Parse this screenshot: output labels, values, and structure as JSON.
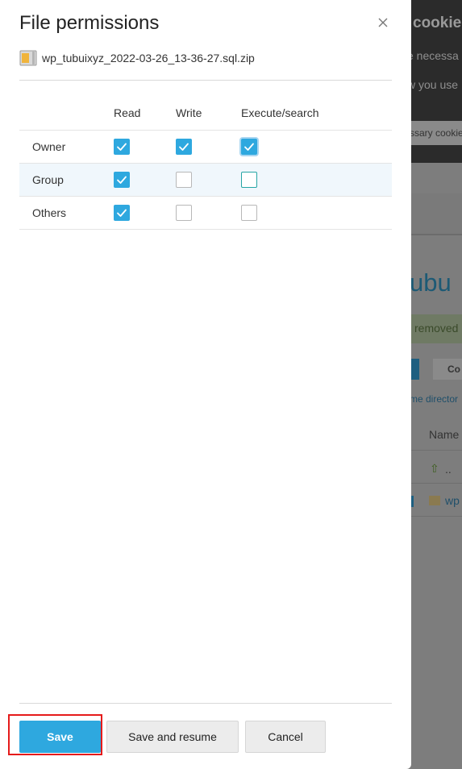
{
  "background": {
    "cookie_title": "cookie",
    "cookie_lines": [
      "e necessa",
      "w you use"
    ],
    "cookie_button": "ssary cookie",
    "heading": "ubu",
    "alert_text": "removed",
    "gray_button": "Co",
    "link_text": "me director",
    "column_name": "Name",
    "up_label": "..",
    "file_link": "wp"
  },
  "dialog": {
    "title": "File permissions",
    "file_name": "wp_tubuixyz_2022-03-26_13-36-27.sql.zip",
    "columns": [
      "Read",
      "Write",
      "Execute/search"
    ],
    "rows": [
      {
        "label": "Owner",
        "read": true,
        "write": true,
        "execute": true
      },
      {
        "label": "Group",
        "read": true,
        "write": false,
        "execute": false
      },
      {
        "label": "Others",
        "read": true,
        "write": false,
        "execute": false
      }
    ],
    "buttons": {
      "save": "Save",
      "save_resume": "Save and resume",
      "cancel": "Cancel"
    }
  },
  "colors": {
    "accent": "#2ea8df",
    "highlight": "#e51b1b"
  }
}
